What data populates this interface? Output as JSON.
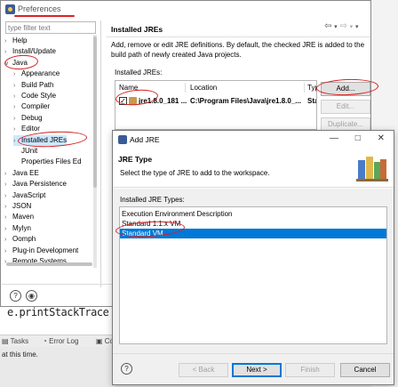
{
  "background": {
    "code_line": "e.printStackTrace",
    "views": [
      "Tasks",
      "Error Log",
      "Co"
    ],
    "status_message": "at this time."
  },
  "preferences": {
    "title": "Preferences",
    "filter_placeholder": "type filter text",
    "tree": [
      {
        "label": "Help",
        "twisty": ">",
        "indent": 0
      },
      {
        "label": "Install/Update",
        "twisty": ">",
        "indent": 0
      },
      {
        "label": "Java",
        "twisty": "v",
        "indent": 0
      },
      {
        "label": "Appearance",
        "twisty": ">",
        "indent": 1
      },
      {
        "label": "Build Path",
        "twisty": ">",
        "indent": 1
      },
      {
        "label": "Code Style",
        "twisty": ">",
        "indent": 1
      },
      {
        "label": "Compiler",
        "twisty": ">",
        "indent": 1
      },
      {
        "label": "Debug",
        "twisty": ">",
        "indent": 1
      },
      {
        "label": "Editor",
        "twisty": ">",
        "indent": 1
      },
      {
        "label": "Installed JREs",
        "twisty": ">",
        "indent": 1,
        "selected": true
      },
      {
        "label": "JUnit",
        "twisty": "",
        "indent": 1
      },
      {
        "label": "Properties Files Ed",
        "twisty": "",
        "indent": 1
      },
      {
        "label": "Java EE",
        "twisty": ">",
        "indent": 0
      },
      {
        "label": "Java Persistence",
        "twisty": ">",
        "indent": 0
      },
      {
        "label": "JavaScript",
        "twisty": ">",
        "indent": 0
      },
      {
        "label": "JSON",
        "twisty": ">",
        "indent": 0
      },
      {
        "label": "Maven",
        "twisty": ">",
        "indent": 0
      },
      {
        "label": "Mylyn",
        "twisty": ">",
        "indent": 0
      },
      {
        "label": "Oomph",
        "twisty": ">",
        "indent": 0
      },
      {
        "label": "Plug-in Development",
        "twisty": ">",
        "indent": 0
      },
      {
        "label": "Remote Systems",
        "twisty": ">",
        "indent": 0
      }
    ],
    "page_title": "Installed JREs",
    "page_description": "Add, remove or edit JRE definitions. By default, the checked JRE is added to the build path of newly created Java projects.",
    "jres_label": "Installed JREs:",
    "table_headers": [
      "Name",
      "Location",
      "Typ"
    ],
    "jre_row": {
      "name": "jre1.8.0_181 ...",
      "location": "C:\\Program Files\\Java\\jre1.8.0_...",
      "type": "Sta",
      "checked": "✓"
    },
    "buttons": {
      "add": "Add...",
      "edit": "Edit...",
      "duplicate": "Duplicate..."
    },
    "bottom_icons": [
      "?",
      "◉"
    ]
  },
  "add_jre": {
    "title": "Add JRE",
    "controls": "— □ ✕",
    "heading": "JRE Type",
    "description": "Select the type of JRE to add to the workspace.",
    "types_label": "Installed JRE Types:",
    "types": [
      {
        "label": "Execution Environment Description",
        "selected": false
      },
      {
        "label": "Standard 1.1.x VM",
        "selected": false
      },
      {
        "label": "Standard VM",
        "selected": true
      }
    ],
    "help": "?",
    "buttons": {
      "back": "< Back",
      "next": "Next >",
      "finish": "Finish",
      "cancel": "Cancel"
    }
  },
  "colors": {
    "selection": "#0078d7",
    "annotation": "#d61f1f",
    "tree_selection": "#cde8ff"
  }
}
